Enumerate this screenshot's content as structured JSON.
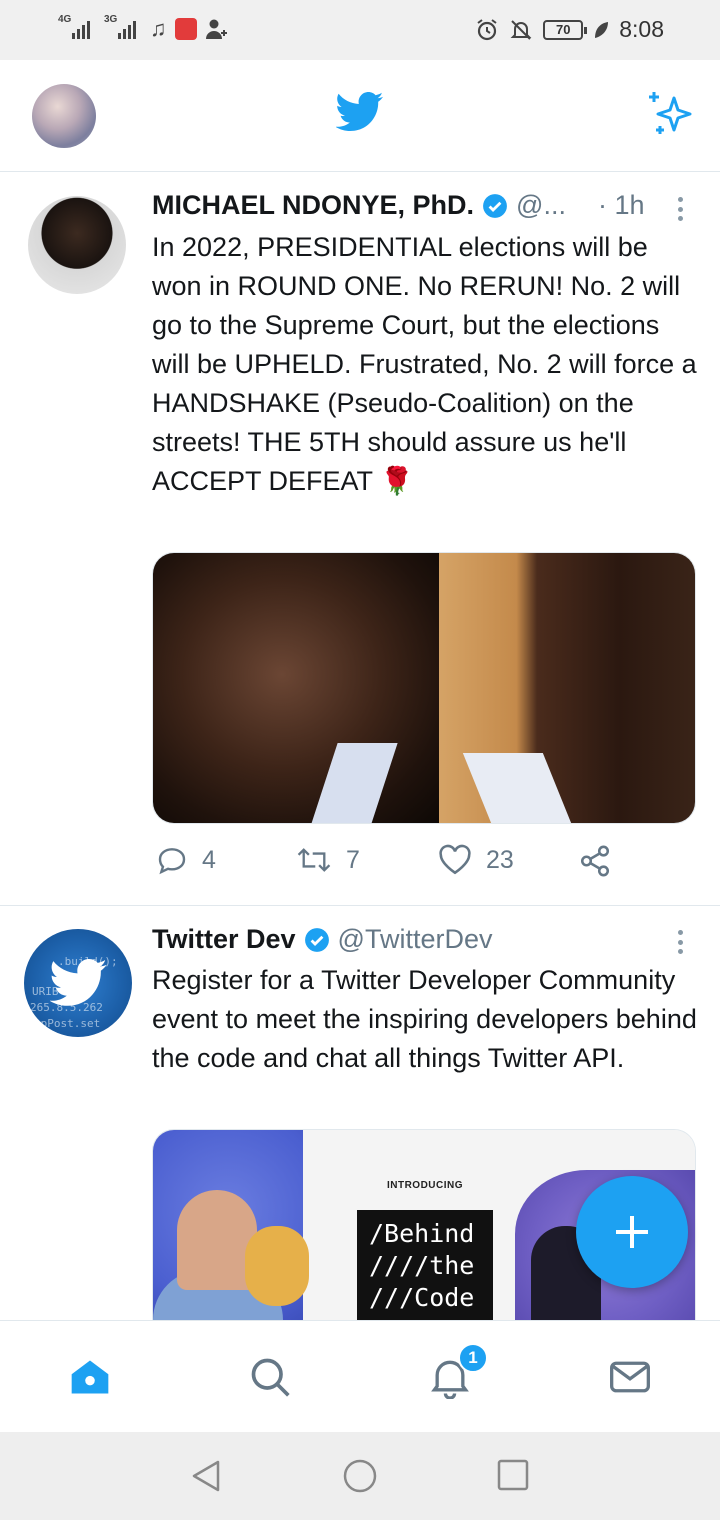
{
  "status_bar": {
    "net1": "4G",
    "net2": "3G",
    "battery": "70",
    "time": "8:08"
  },
  "topbar": {
    "logo_icon": "twitter-bird-icon",
    "sparkle_icon": "sparkle-icon",
    "accent_color": "#1da1f2"
  },
  "tweets": [
    {
      "name": "MICHAEL NDONYE, PhD.",
      "handle": "@...",
      "time": "· 1h",
      "text": "In 2022, PRESIDENTIAL elections will be won in ROUND ONE. No RERUN! No. 2 will go to the Supreme Court, but the elections will be UPHELD. Frustrated, No. 2 will force a HANDSHAKE (Pseudo-Coalition) on the streets! THE 5TH should assure us he'll ACCEPT DEFEAT 🌹",
      "replies": "4",
      "retweets": "7",
      "likes": "23"
    },
    {
      "name": "Twitter Dev",
      "handle": "@TwitterDev",
      "text": "Register for a Twitter Developer Community event to meet the inspiring developers behind the code and chat all things Twitter API.",
      "avatar_code": [
        ".build();",
        "URIB",
        "265.8.5.262",
        "tpPost.set"
      ],
      "media": {
        "intro": "INTRODUCING",
        "title_lines": [
          "/Behind",
          "////the",
          "///Code"
        ]
      }
    }
  ],
  "bottom_nav": {
    "notifications_badge": "1"
  }
}
